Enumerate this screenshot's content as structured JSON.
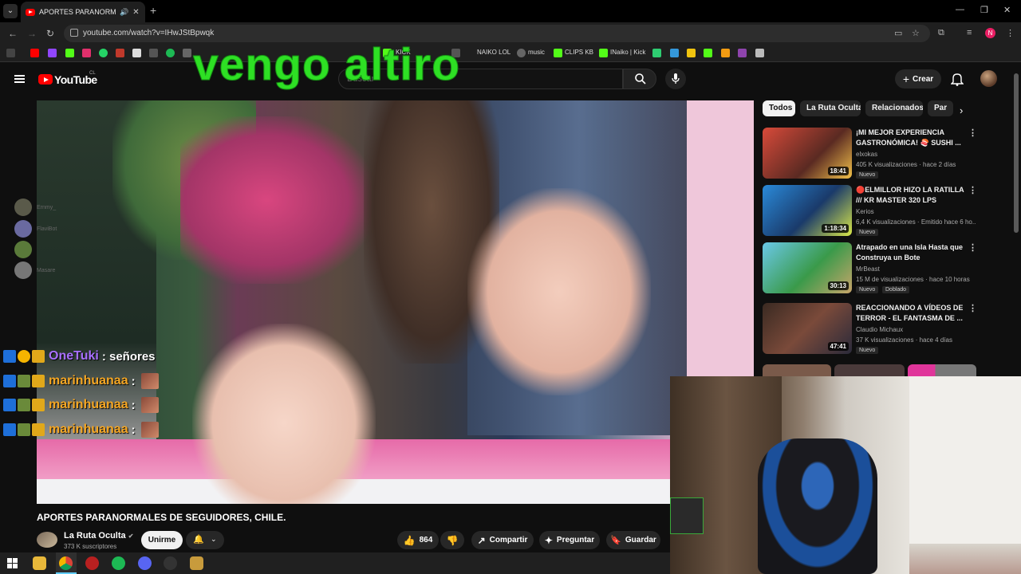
{
  "browser": {
    "tab_title": "APORTES PARANORMALES",
    "url": "youtube.com/watch?v=IHwJStBpwqk",
    "profile_initial": "N",
    "bookmarks": [
      {
        "label": "KICK",
        "color": "#53fc18"
      },
      {
        "label": "NAIKO LOL",
        "color": "#7c7c7c"
      },
      {
        "label": "music",
        "color": "#888888"
      },
      {
        "label": "CLIPS KB",
        "color": "#53fc18"
      },
      {
        "label": "INaiko | Kick",
        "color": "#53fc18"
      }
    ]
  },
  "overlay": {
    "text": "vengo altiro",
    "color": "#2ee024"
  },
  "youtube": {
    "logo_text": "YouTube",
    "country": "CL",
    "search_placeholder": "Buscar",
    "create_label": "Crear"
  },
  "video": {
    "title": "APORTES PARANORMALES DE SEGUIDORES, CHILE.",
    "channel": "La Ruta Oculta",
    "subscribers": "373 K suscriptores",
    "join_label": "Unirme",
    "likes": "864",
    "share_label": "Compartir",
    "ask_label": "Preguntar",
    "save_label": "Guardar"
  },
  "chat": {
    "viewers": [
      {
        "name": "Ernmy_"
      },
      {
        "name": "FlaviBot"
      },
      {
        "name": ""
      },
      {
        "name": "Masare"
      }
    ],
    "messages": [
      {
        "user": "OneTuki",
        "color": "#a970ff",
        "text": ": señores"
      },
      {
        "user": "marinhuanaa",
        "color": "#f5a623",
        "text": ":"
      },
      {
        "user": "marinhuanaa",
        "color": "#f5a623",
        "text": ":"
      },
      {
        "user": "marinhuanaa",
        "color": "#f5a623",
        "text": ":"
      }
    ]
  },
  "sidebar": {
    "chips": [
      "Todos",
      "La Ruta Oculta",
      "Relacionados",
      "Par"
    ],
    "recommendations": [
      {
        "title": "¡MI MEJOR EXPERIENCIA GASTRONÓMICA! 🍣 SUSHI ...",
        "channel": "elxokas",
        "meta": "405 K visualizaciones · hace 2 días",
        "duration": "18:41",
        "badge": "Nuevo",
        "thumb": "#b23a2a"
      },
      {
        "title": "🔴ELMILLOR HIZO LA RATILLA /// KR MASTER 320 LPS",
        "channel": "Kerios",
        "meta": "6,4 K visualizaciones · Emitido hace 6 ho...",
        "duration": "1:18:34",
        "badge": "Nuevo",
        "thumb": "#2a6fb2"
      },
      {
        "title": "Atrapado en una Isla Hasta que Construya un Bote",
        "channel": "MrBeast",
        "meta": "15 M de visualizaciones · hace 10 horas",
        "duration": "30:13",
        "badge": "Nuevo",
        "badge2": "Doblado",
        "thumb": "#3a9a4a"
      },
      {
        "title": "REACCIONANDO A VÍDEOS DE TERROR - EL FANTASMA DE ...",
        "channel": "Claudio Michaux",
        "meta": "37 K visualizaciones · hace 4 días",
        "duration": "47:41",
        "badge": "Nuevo",
        "thumb": "#5a3a2a"
      }
    ]
  }
}
